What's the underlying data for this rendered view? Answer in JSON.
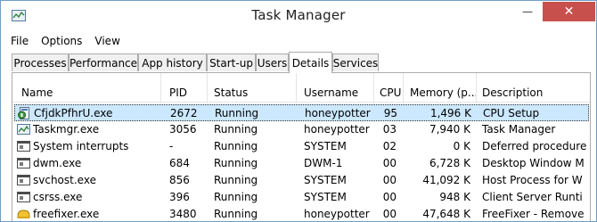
{
  "window": {
    "title": "Task Manager",
    "minimize_glyph": "—",
    "maximize_glyph": "",
    "close_glyph": "✕"
  },
  "menu": [
    "File",
    "Options",
    "View"
  ],
  "tabs": [
    {
      "label": "Processes",
      "active": false
    },
    {
      "label": "Performance",
      "active": false
    },
    {
      "label": "App history",
      "active": false
    },
    {
      "label": "Start-up",
      "active": false
    },
    {
      "label": "Users",
      "active": false
    },
    {
      "label": "Details",
      "active": true
    },
    {
      "label": "Services",
      "active": false
    }
  ],
  "table": {
    "sort_indicator": "⌃",
    "columns": {
      "name": "Name",
      "pid": "PID",
      "status": "Status",
      "username": "Username",
      "cpu": "CPU",
      "memory": "Memory (p...",
      "description": "Description"
    },
    "rows": [
      {
        "icon": "setup-app-icon",
        "name": "CfjdkPfhrU.exe",
        "pid": "2672",
        "status": "Running",
        "username": "honeypotter",
        "cpu": "95",
        "memory": "1,496 K",
        "description": "CPU Setup",
        "selected": true
      },
      {
        "icon": "task-manager-icon",
        "name": "Taskmgr.exe",
        "pid": "3056",
        "status": "Running",
        "username": "honeypotter",
        "cpu": "03",
        "memory": "7,940 K",
        "description": "Task Manager",
        "selected": false
      },
      {
        "icon": "window-app-icon",
        "name": "System interrupts",
        "pid": "-",
        "status": "Running",
        "username": "SYSTEM",
        "cpu": "02",
        "memory": "0 K",
        "description": "Deferred procedure",
        "selected": false
      },
      {
        "icon": "window-app-icon",
        "name": "dwm.exe",
        "pid": "684",
        "status": "Running",
        "username": "DWM-1",
        "cpu": "00",
        "memory": "6,728 K",
        "description": "Desktop Window M",
        "selected": false
      },
      {
        "icon": "window-app-icon",
        "name": "svchost.exe",
        "pid": "856",
        "status": "Running",
        "username": "SYSTEM",
        "cpu": "00",
        "memory": "41,092 K",
        "description": "Host Process for W",
        "selected": false
      },
      {
        "icon": "window-app-icon",
        "name": "csrss.exe",
        "pid": "396",
        "status": "Running",
        "username": "SYSTEM",
        "cpu": "00",
        "memory": "948 K",
        "description": "Client Server Runti",
        "selected": false
      },
      {
        "icon": "freefixer-icon",
        "name": "freefixer.exe",
        "pid": "3480",
        "status": "Running",
        "username": "honeypotter",
        "cpu": "00",
        "memory": "47,648 K",
        "description": "FreeFixer - Remove",
        "selected": false
      }
    ]
  },
  "colors": {
    "selection": "#cce8ff",
    "close_button": "#c7504d",
    "window_border": "#6f9ec6"
  }
}
